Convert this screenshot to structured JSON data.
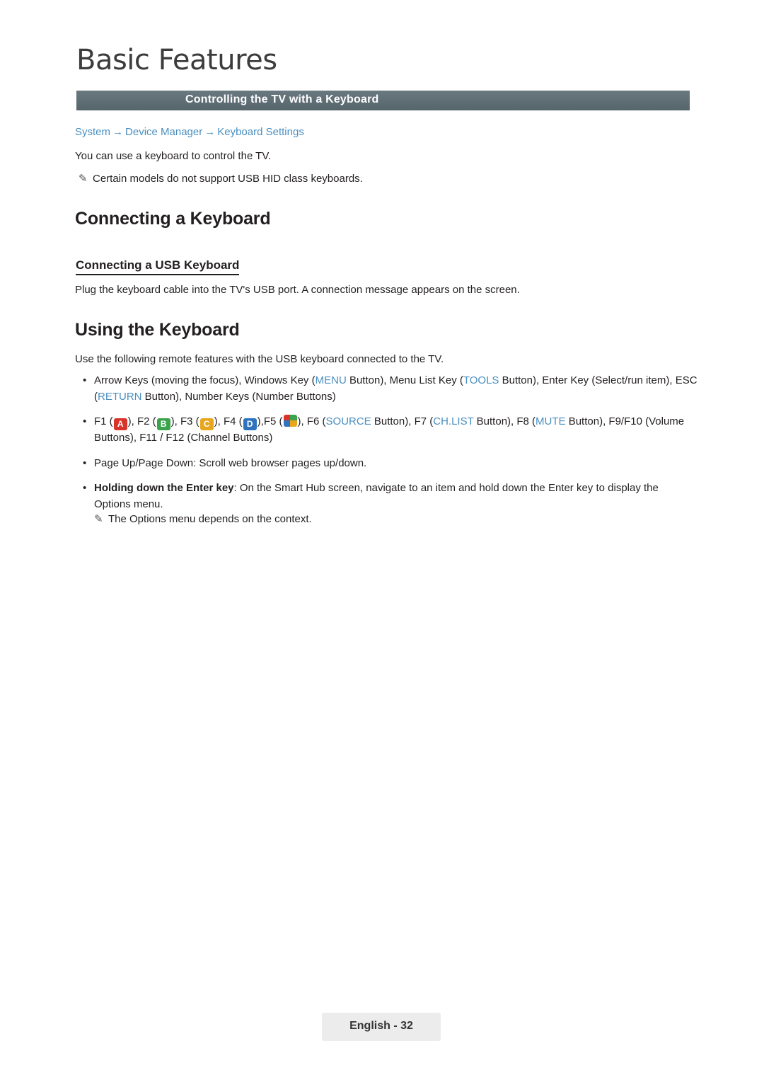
{
  "chapter": {
    "title": "Basic Features"
  },
  "section": {
    "label": "Controlling the TV with a Keyboard"
  },
  "breadcrumb": {
    "item1": "System",
    "arrow1": "→",
    "item2": "Device Manager",
    "arrow2": "→",
    "item3": "Keyboard Settings"
  },
  "intro": {
    "line": "You can use a keyboard to control the TV.",
    "note": "Certain models do not support USB HID class keyboards."
  },
  "connecting": {
    "heading": "Connecting a Keyboard",
    "subheading": "Connecting a USB Keyboard",
    "paragraph": "Plug the keyboard cable into the TV's USB port. A connection message appears on the screen."
  },
  "using": {
    "heading": "Using the Keyboard",
    "paragraph": "Use the following remote features with the USB keyboard connected to the TV.",
    "bullets": [
      {
        "id": "arrow-keys",
        "parts": [
          {
            "t": "text",
            "v": "Arrow Keys (moving the focus), Windows Key ("
          },
          {
            "t": "blue",
            "v": "MENU"
          },
          {
            "t": "text",
            "v": " Button), Menu List Key ("
          },
          {
            "t": "blue",
            "v": "TOOLS"
          },
          {
            "t": "text",
            "v": " Button), Enter Key (Select/run item), ESC ("
          },
          {
            "t": "blue",
            "v": "RETURN"
          },
          {
            "t": "text",
            "v": " Button), Number Keys (Number Buttons)"
          }
        ]
      },
      {
        "id": "function-keys",
        "parts": [
          {
            "t": "text",
            "v": "F1 ("
          },
          {
            "t": "key",
            "v": "A"
          },
          {
            "t": "text",
            "v": "), F2 ("
          },
          {
            "t": "key",
            "v": "B"
          },
          {
            "t": "text",
            "v": "), F3 ("
          },
          {
            "t": "key",
            "v": "C"
          },
          {
            "t": "text",
            "v": "), F4 ("
          },
          {
            "t": "key",
            "v": "D"
          },
          {
            "t": "text",
            "v": "),F5 ("
          },
          {
            "t": "key",
            "v": "P"
          },
          {
            "t": "text",
            "v": "), F6 ("
          },
          {
            "t": "blue",
            "v": "SOURCE"
          },
          {
            "t": "text",
            "v": " Button), F7 ("
          },
          {
            "t": "blue",
            "v": "CH.LIST"
          },
          {
            "t": "text",
            "v": " Button), F8 ("
          },
          {
            "t": "blue",
            "v": "MUTE"
          },
          {
            "t": "text",
            "v": " Button), F9/F10 (Volume Buttons), F11 / F12 (Channel Buttons)"
          }
        ]
      },
      {
        "id": "page-up-down",
        "parts": [
          {
            "t": "text",
            "v": "Page Up/Page Down: Scroll web browser pages up/down."
          }
        ]
      },
      {
        "id": "holding-enter",
        "parts": [
          {
            "t": "bold",
            "v": "Holding down the Enter key"
          },
          {
            "t": "text",
            "v": ": On the Smart Hub screen, navigate to an item and hold down the Enter key to display the Options menu."
          }
        ]
      }
    ],
    "note": "The Options menu depends on the context."
  },
  "footer": {
    "label": "English - 32"
  },
  "icons": {
    "pencil": "✎"
  },
  "colors": {
    "link": "#4a8fbf",
    "section_bar": "#5c6a72",
    "key_a": "#d8342b",
    "key_b": "#3aa34b",
    "key_c": "#e8a61c",
    "key_d": "#2f72bd",
    "footer_bg": "#ececec"
  }
}
